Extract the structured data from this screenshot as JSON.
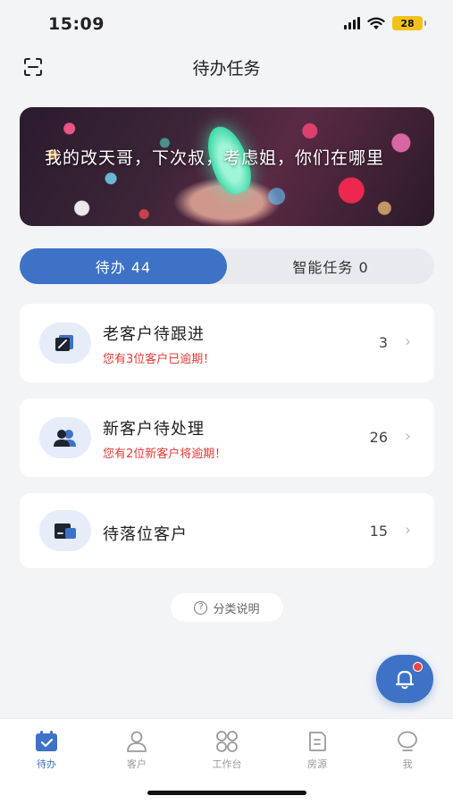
{
  "status_bar": {
    "time": "15:09",
    "battery": "28"
  },
  "header": {
    "title": "待办任务",
    "scan_icon": "scan-icon"
  },
  "banner": {
    "text": "我的改天哥，下次叔，考虑姐，你们在哪里"
  },
  "segments": {
    "active_label": "待办 44",
    "inactive_label": "智能任务 0"
  },
  "tasks": [
    {
      "title": "老客户待跟进",
      "subtitle": "您有3位客户已逾期！",
      "count": "3",
      "icon": "edit-icon"
    },
    {
      "title": "新客户待处理",
      "subtitle": "您有2位新客户将逾期！",
      "count": "26",
      "icon": "users-icon"
    },
    {
      "title": "待落位客户",
      "subtitle": "",
      "count": "15",
      "icon": "wallet-icon"
    }
  ],
  "help": {
    "label": "分类说明",
    "icon": "question-icon"
  },
  "fab": {
    "icon": "bell-icon"
  },
  "tabbar": {
    "items": [
      {
        "label": "待办",
        "icon": "calendar-check-icon",
        "active": true
      },
      {
        "label": "客户",
        "icon": "user-icon",
        "active": false
      },
      {
        "label": "工作台",
        "icon": "grid-icon",
        "active": false
      },
      {
        "label": "房源",
        "icon": "document-icon",
        "active": false
      },
      {
        "label": "我",
        "icon": "profile-icon",
        "active": false
      }
    ]
  },
  "colors": {
    "primary": "#3d72c7",
    "warning": "#e53935",
    "background": "#f3f4f6"
  }
}
